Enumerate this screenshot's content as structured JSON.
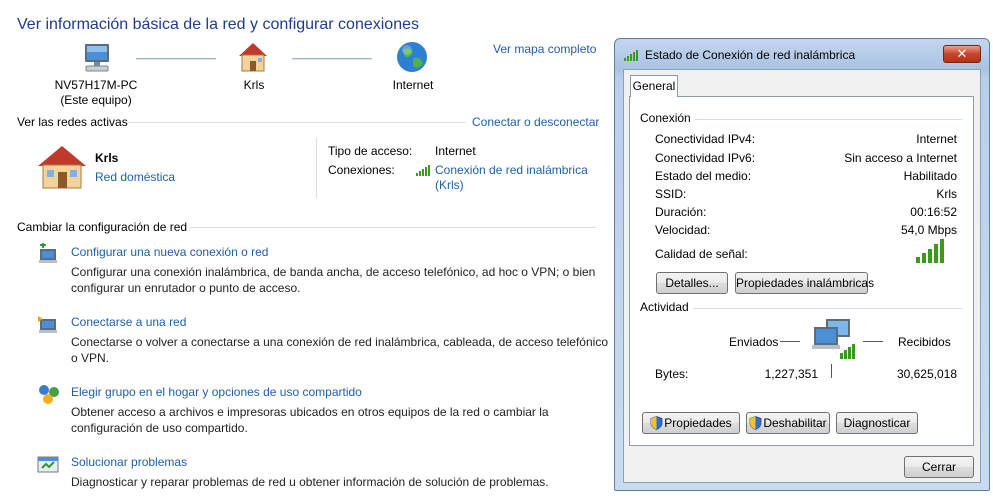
{
  "page": {
    "title": "Ver información básica de la red y configurar conexiones",
    "map_link": "Ver mapa completo"
  },
  "network_map": {
    "computer_name": "NV57H17M-PC",
    "computer_sub": "(Este equipo)",
    "network_name": "Krls",
    "internet": "Internet"
  },
  "active_networks": {
    "header": "Ver las redes activas",
    "connect_link": "Conectar o desconectar",
    "name": "Krls",
    "type": "Red doméstica",
    "access_label": "Tipo de acceso:",
    "access_value": "Internet",
    "connections_label": "Conexiones:",
    "connection_line1": "Conexión de red inalámbrica",
    "connection_line2": "(Krls)"
  },
  "change_settings": {
    "header": "Cambiar la configuración de red",
    "tasks": [
      {
        "icon": "new-connection-icon",
        "title": "Configurar una nueva conexión o red",
        "desc1": "Configurar una conexión inalámbrica, de banda ancha, de acceso telefónico, ad hoc o VPN; o bien",
        "desc2": "configurar un enrutador o punto de acceso."
      },
      {
        "icon": "connect-network-icon",
        "title": "Conectarse a una red",
        "desc1": "Conectarse o volver a conectarse a una conexión de red inalámbrica, cableada, de acceso telefónico",
        "desc2": "o VPN."
      },
      {
        "icon": "homegroup-icon",
        "title": "Elegir grupo en el hogar y opciones de uso compartido",
        "desc1": "Obtener acceso a archivos e impresoras ubicados en otros equipos de la red o cambiar la",
        "desc2": "configuración de uso compartido."
      },
      {
        "icon": "troubleshoot-icon",
        "title": "Solucionar problemas",
        "desc1": "Diagnosticar y reparar problemas de red u obtener información de solución de problemas.",
        "desc2": ""
      }
    ]
  },
  "dialog": {
    "title": "Estado de Conexión de red inalámbrica",
    "close_glyph": "✕",
    "tab": "General",
    "connection_group": "Conexión",
    "rows": [
      {
        "label": "Conectividad IPv4:",
        "value": "Internet"
      },
      {
        "label": "Conectividad IPv6:",
        "value": "Sin acceso a Internet"
      },
      {
        "label": "Estado del medio:",
        "value": "Habilitado"
      },
      {
        "label": "SSID:",
        "value": "Krls"
      },
      {
        "label": "Duración:",
        "value": "00:16:52"
      },
      {
        "label": "Velocidad:",
        "value": "54,0 Mbps"
      }
    ],
    "signal_label": "Calidad de señal:",
    "details_button": "Detalles...",
    "wireless_props_button": "Propiedades inalámbricas",
    "activity_group": "Actividad",
    "sent_label": "Enviados",
    "received_label": "Recibidos",
    "bytes_label": "Bytes:",
    "bytes_sent": "1,227,351",
    "bytes_received": "30,625,018",
    "properties_button": "Propiedades",
    "disable_button": "Deshabilitar",
    "diagnose_button": "Diagnosticar",
    "close_button": "Cerrar"
  },
  "colors": {
    "link": "#1e5fa8",
    "title": "#1e3d8a",
    "signal_green": "#3a9a1a"
  }
}
